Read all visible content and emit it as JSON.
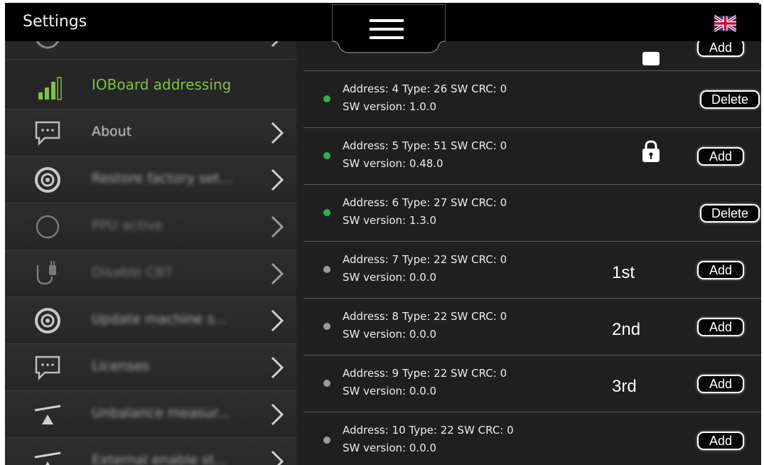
{
  "header": {
    "title": "Settings",
    "menu_icon": "hamburger-menu-icon",
    "language_flag": "uk-flag-icon"
  },
  "sidebar": {
    "items": [
      {
        "label": "IOBoard addressing",
        "icon": "signal-bars-icon",
        "active": true
      },
      {
        "label": "About",
        "icon": "speech-bubble-icon"
      },
      {
        "label": "Restore factory set...",
        "icon": "restore-icon"
      },
      {
        "label": "PPU active",
        "icon": "circle-icon"
      },
      {
        "label": "Disable CBT",
        "icon": "plug-icon"
      },
      {
        "label": "Update machine s...",
        "icon": "update-icon"
      },
      {
        "label": "Licenses",
        "icon": "speech-bubble-icon"
      },
      {
        "label": "Unbalance measur...",
        "icon": "balance-icon"
      },
      {
        "label": "External enable st...",
        "icon": "balance-icon"
      }
    ]
  },
  "main": {
    "partial_top_button": "Add",
    "rows": [
      {
        "line1": "Address: 4  Type: 26  SW CRC: 0",
        "line2": "SW version: 1.0.0",
        "status": "green",
        "action": "Delete"
      },
      {
        "line1": "Address: 5  Type: 51  SW CRC: 0",
        "line2": "SW version: 0.48.0",
        "status": "green",
        "action": "Add",
        "locked": true
      },
      {
        "line1": "Address: 6  Type: 27  SW CRC: 0",
        "line2": "SW version: 1.3.0",
        "status": "green",
        "action": "Delete"
      },
      {
        "line1": "Address: 7  Type: 22  SW CRC: 0",
        "line2": "SW version: 0.0.0",
        "status": "grey",
        "action": "Add",
        "order": "1st"
      },
      {
        "line1": "Address: 8  Type: 22  SW CRC: 0",
        "line2": "SW version: 0.0.0",
        "status": "grey",
        "action": "Add",
        "order": "2nd"
      },
      {
        "line1": "Address: 9  Type: 22  SW CRC: 0",
        "line2": "SW version: 0.0.0",
        "status": "grey",
        "action": "Add",
        "order": "3rd"
      },
      {
        "line1": "Address: 10  Type: 22  SW CRC: 0",
        "line2": "SW version: 0.0.0",
        "status": "grey",
        "action": "Add"
      }
    ]
  },
  "colors": {
    "accent_green": "#7ec242",
    "status_green": "#2db34a",
    "status_grey": "#9a9a9a",
    "background": "#1c1c1c"
  }
}
